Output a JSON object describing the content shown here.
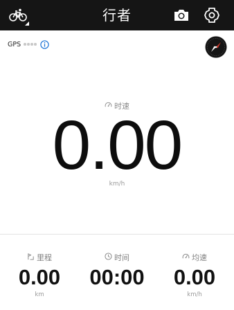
{
  "header": {
    "title": "行者",
    "left_icon": "bicycle-icon",
    "camera_icon": "camera-icon",
    "settings_icon": "settings-icon",
    "background": "#151515"
  },
  "gps": {
    "label": "GPS",
    "signal_bars_active": 0,
    "signal_bars_total": 4,
    "info_icon": "info-icon"
  },
  "compass": {
    "icon": "compass-icon"
  },
  "speed": {
    "label": "时速",
    "value": "0.00",
    "unit": "km/h"
  },
  "stats": [
    {
      "label": "里程",
      "value": "0.00",
      "unit": "km",
      "icon": "distance-icon"
    },
    {
      "label": "时间",
      "value": "00:00",
      "unit": "",
      "icon": "clock-icon"
    },
    {
      "label": "均速",
      "value": "0.00",
      "unit": "km/h",
      "icon": "speedometer-icon"
    }
  ],
  "colors": {
    "info_blue": "#1c73d6",
    "compass_red": "#d83a2e"
  }
}
